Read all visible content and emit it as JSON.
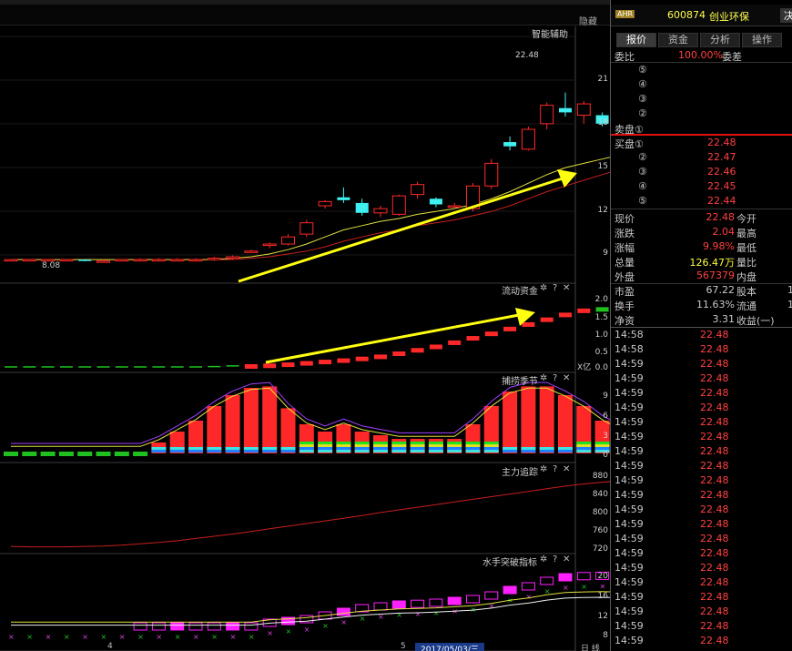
{
  "header": {
    "hide_label": "隐藏",
    "stock_badge": "AHR",
    "stock_code": "600874",
    "stock_name": "创业环保",
    "decision_label": "决"
  },
  "tabs": [
    {
      "label": "报价"
    },
    {
      "label": "资金"
    },
    {
      "label": "分析"
    },
    {
      "label": "操作"
    }
  ],
  "panels": {
    "main": {
      "title": "智能辅助",
      "high_label": "22.48",
      "low_label": "8.08",
      "axis": [
        "21",
        "18",
        "15",
        "12",
        "9"
      ]
    },
    "flow": {
      "title": "流动资金",
      "axis": [
        "2.0",
        "1.5",
        "1.0",
        "0.5",
        "0.0"
      ],
      "unit": "X亿"
    },
    "season": {
      "title": "捕捞季节",
      "axis": [
        "9",
        "6",
        "3",
        "0"
      ]
    },
    "main_track": {
      "title": "主力追踪",
      "axis": [
        "880",
        "840",
        "800",
        "760",
        "720"
      ]
    },
    "sailor": {
      "title": "水手突破指标",
      "axis": [
        "20",
        "16",
        "12",
        "8"
      ]
    },
    "controls": {
      "settings": "✲",
      "help": "?",
      "close": "✕"
    }
  },
  "footer": {
    "x_tick_1": "4",
    "x_tick_2": "5",
    "date": "2017/05/03/三",
    "corner": "日 线"
  },
  "quote": {
    "order_ratio_label": "委比",
    "order_ratio_value": "100.00%",
    "order_diff_label": "委差",
    "sell_levels": [
      "⑤",
      "④",
      "③",
      "②"
    ],
    "sell_1_label": "卖盘①",
    "buy_1_label": "买盘①",
    "buy_levels": [
      {
        "level": "①",
        "price": "22.48"
      },
      {
        "level": "②",
        "price": "22.47"
      },
      {
        "level": "③",
        "price": "22.46"
      },
      {
        "level": "④",
        "price": "22.45"
      },
      {
        "level": "⑤",
        "price": "22.44"
      }
    ],
    "stats": [
      {
        "label": "现价",
        "value": "22.48",
        "right": "今开",
        "color": "red"
      },
      {
        "label": "涨跌",
        "value": "2.04",
        "right": "最高",
        "color": "red"
      },
      {
        "label": "涨幅",
        "value": "9.98%",
        "right": "最低",
        "color": "red"
      },
      {
        "label": "总量",
        "value": "126.47万",
        "right": "量比",
        "color": "yel"
      },
      {
        "label": "外盘",
        "value": "567379",
        "right": "内盘",
        "color": "red"
      }
    ],
    "stats2": [
      {
        "label": "市盈",
        "value": "67.22",
        "right": "股本",
        "extra": "1"
      },
      {
        "label": "换手",
        "value": "11.63%",
        "right": "流通",
        "extra": "1"
      },
      {
        "label": "净资",
        "value": "3.31",
        "right": "收益(一)",
        "extra": ""
      }
    ],
    "ticks": [
      {
        "time": "14:58",
        "price": "22.48"
      },
      {
        "time": "14:58",
        "price": "22.48"
      },
      {
        "time": "14:59",
        "price": "22.48"
      },
      {
        "time": "14:59",
        "price": "22.48"
      },
      {
        "time": "14:59",
        "price": "22.48"
      },
      {
        "time": "14:59",
        "price": "22.48"
      },
      {
        "time": "14:59",
        "price": "22.48"
      },
      {
        "time": "14:59",
        "price": "22.48"
      },
      {
        "time": "14:59",
        "price": "22.48"
      },
      {
        "time": "14:59",
        "price": "22.48"
      },
      {
        "time": "14:59",
        "price": "22.48"
      },
      {
        "time": "14:59",
        "price": "22.48"
      },
      {
        "time": "14:59",
        "price": "22.48"
      },
      {
        "time": "14:59",
        "price": "22.48"
      },
      {
        "time": "14:59",
        "price": "22.48"
      },
      {
        "time": "14:59",
        "price": "22.48"
      },
      {
        "time": "14:59",
        "price": "22.48"
      },
      {
        "time": "14:59",
        "price": "22.48"
      },
      {
        "time": "14:59",
        "price": "22.48"
      },
      {
        "time": "14:59",
        "price": "22.48"
      },
      {
        "time": "14:59",
        "price": "22.48"
      },
      {
        "time": "14:59",
        "price": "22.48"
      }
    ]
  },
  "candles": [
    [
      8.2,
      8.2,
      8.1,
      8.2
    ],
    [
      8.2,
      8.2,
      8.1,
      8.2
    ],
    [
      8.2,
      8.2,
      8.1,
      8.2
    ],
    [
      8.2,
      8.2,
      8.1,
      8.2
    ],
    [
      8.2,
      8.2,
      8.08,
      8.1
    ],
    [
      8.1,
      8.2,
      8.08,
      8.1
    ],
    [
      8.1,
      8.2,
      8.08,
      8.2
    ],
    [
      8.2,
      8.3,
      8.1,
      8.2
    ],
    [
      8.2,
      8.3,
      8.1,
      8.2
    ],
    [
      8.2,
      8.3,
      8.1,
      8.2
    ],
    [
      8.2,
      8.3,
      8.1,
      8.2
    ],
    [
      8.2,
      8.4,
      8.1,
      8.3
    ],
    [
      8.3,
      8.5,
      8.2,
      8.4
    ],
    [
      8.8,
      8.9,
      8.7,
      8.8
    ],
    [
      9.2,
      9.4,
      9.0,
      9.3
    ],
    [
      9.3,
      10.0,
      9.2,
      9.8
    ],
    [
      10.0,
      11.0,
      9.8,
      10.8
    ],
    [
      12.0,
      12.4,
      11.8,
      12.3
    ],
    [
      12.6,
      13.3,
      12.2,
      12.4
    ],
    [
      12.2,
      12.5,
      11.3,
      11.5
    ],
    [
      11.5,
      12.0,
      11.2,
      11.8
    ],
    [
      11.4,
      12.8,
      11.3,
      12.7
    ],
    [
      12.8,
      13.7,
      12.5,
      13.5
    ],
    [
      12.5,
      12.6,
      11.9,
      12.1
    ],
    [
      12.0,
      12.2,
      11.8,
      12.0
    ],
    [
      11.8,
      13.6,
      11.6,
      13.4
    ],
    [
      13.4,
      15.3,
      13.2,
      15.0
    ],
    [
      16.5,
      16.9,
      15.9,
      16.2
    ],
    [
      16.0,
      17.6,
      15.9,
      17.4
    ],
    [
      17.8,
      19.3,
      17.4,
      19.1
    ],
    [
      18.9,
      20.0,
      18.3,
      18.6
    ],
    [
      18.4,
      19.4,
      17.8,
      19.2
    ],
    [
      18.4,
      18.6,
      17.6,
      17.8
    ],
    [
      18.1,
      18.8,
      17.6,
      18.2
    ],
    [
      18.0,
      19.4,
      17.6,
      19.0
    ],
    [
      18.8,
      19.4,
      18.5,
      18.8
    ],
    [
      18.5,
      21.0,
      18.3,
      20.4
    ],
    [
      20.6,
      22.48,
      20.6,
      22.48
    ]
  ],
  "ma_short": [
    8.2,
    8.2,
    8.2,
    8.2,
    8.2,
    8.2,
    8.2,
    8.2,
    8.2,
    8.2,
    8.2,
    8.2,
    8.3,
    8.4,
    8.6,
    8.9,
    9.3,
    9.8,
    10.3,
    10.6,
    10.9,
    11.1,
    11.4,
    11.6,
    11.8,
    12.1,
    12.5,
    13.0,
    13.6,
    14.2,
    14.7,
    15.0,
    15.3,
    15.6,
    15.9,
    16.2,
    16.7,
    17.3
  ],
  "ma_long": [
    8.2,
    8.2,
    8.2,
    8.2,
    8.2,
    8.2,
    8.2,
    8.2,
    8.2,
    8.2,
    8.2,
    8.2,
    8.2,
    8.3,
    8.4,
    8.6,
    8.8,
    9.1,
    9.5,
    9.8,
    10.1,
    10.3,
    10.6,
    10.8,
    11.0,
    11.3,
    11.6,
    12.0,
    12.5,
    13.0,
    13.4,
    13.8,
    14.2,
    14.6,
    14.9,
    15.2,
    15.6,
    16.1
  ],
  "flow_values": [
    0.02,
    0.02,
    0.02,
    0.02,
    0.02,
    0.02,
    0.02,
    0.02,
    0.02,
    0.02,
    0.02,
    0.03,
    0.05,
    0.08,
    0.1,
    0.13,
    0.17,
    0.21,
    0.25,
    0.3,
    0.36,
    0.45,
    0.55,
    0.65,
    0.77,
    0.9,
    1.03,
    1.17,
    1.3,
    1.44,
    1.58,
    1.7,
    1.74,
    1.76,
    1.78,
    1.82,
    1.96,
    2.1
  ],
  "season_values": [
    0.5,
    0.5,
    0.5,
    0.5,
    0.5,
    0.5,
    0.5,
    0.5,
    1.5,
    3.0,
    4.5,
    6.5,
    8.0,
    9.0,
    9.2,
    6.2,
    4.0,
    3.0,
    4.0,
    3.0,
    2.5,
    2.0,
    2.0,
    2.0,
    2.0,
    4.0,
    6.5,
    8.5,
    9.2,
    9.2,
    8.0,
    6.5,
    4.5,
    3.0,
    2.0,
    2.0,
    2.0,
    3.5
  ],
  "track_values": [
    720,
    719,
    719,
    719,
    720,
    721,
    723,
    726,
    729,
    733,
    738,
    743,
    748,
    754,
    760,
    766,
    772,
    778,
    784,
    790,
    797,
    803,
    809,
    815,
    821,
    827,
    833,
    839,
    845,
    851,
    857,
    862,
    866,
    870,
    874,
    878,
    882,
    885
  ],
  "sailor_values": [
    5,
    5,
    5,
    5,
    5,
    5,
    5,
    5,
    5,
    5,
    5,
    5,
    5,
    5,
    6,
    6.5,
    7,
    8,
    9,
    10,
    10.5,
    11,
    11.2,
    11.5,
    12,
    12.5,
    13.5,
    15,
    16,
    17.5,
    18.5,
    18.8,
    18.9,
    18.7,
    18.6,
    18.8,
    19.5,
    21
  ],
  "colors": {
    "up": "#ff2828",
    "down": "#40f0f0",
    "ma_short": "#e0e040",
    "ma_long": "#c81e1e",
    "arrow": "#ffff10",
    "magenta": "#ff20ff"
  }
}
